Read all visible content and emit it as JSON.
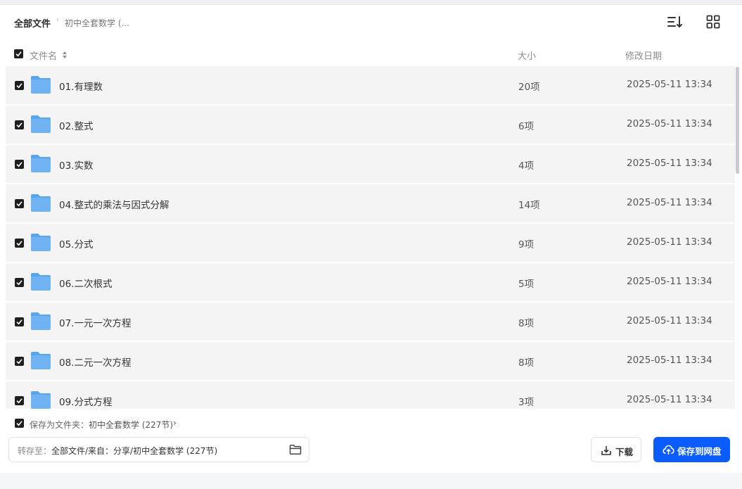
{
  "breadcrumb": {
    "root": "全部文件",
    "separator": "›",
    "current": "初中全套数学 (..."
  },
  "toolbar": {
    "sort_icon": "sort-list-icon",
    "view_icon": "grid-view-icon"
  },
  "table": {
    "columns": {
      "name": "文件名",
      "size": "大小",
      "date": "修改日期"
    },
    "rows": [
      {
        "name": "01.有理数",
        "size": "20项",
        "date": "2025-05-11 13:34"
      },
      {
        "name": "02.整式",
        "size": "6项",
        "date": "2025-05-11 13:34"
      },
      {
        "name": "03.实数",
        "size": "4项",
        "date": "2025-05-11 13:34"
      },
      {
        "name": "04.整式的乘法与因式分解",
        "size": "14项",
        "date": "2025-05-11 13:34"
      },
      {
        "name": "05.分式",
        "size": "9项",
        "date": "2025-05-11 13:34"
      },
      {
        "name": "06.二次根式",
        "size": "5项",
        "date": "2025-05-11 13:34"
      },
      {
        "name": "07.一元一次方程",
        "size": "8项",
        "date": "2025-05-11 13:34"
      },
      {
        "name": "08.二元一次方程",
        "size": "8项",
        "date": "2025-05-11 13:34"
      },
      {
        "name": "09.分式方程",
        "size": "3项",
        "date": "2025-05-11 13:34"
      }
    ]
  },
  "save_as_folder": {
    "label": "保存为文件夹：",
    "value": "初中全套数学 (227节)",
    "chevron": "›"
  },
  "destination": {
    "label": "转存至：",
    "value": "全部文件/来自：分享/初中全套数学 (227节)"
  },
  "buttons": {
    "download": "下载",
    "save": "保存到网盘"
  },
  "colors": {
    "primary": "#0b5cff",
    "row_bg": "#f4f4f5",
    "folder": "#6fb3f2"
  }
}
